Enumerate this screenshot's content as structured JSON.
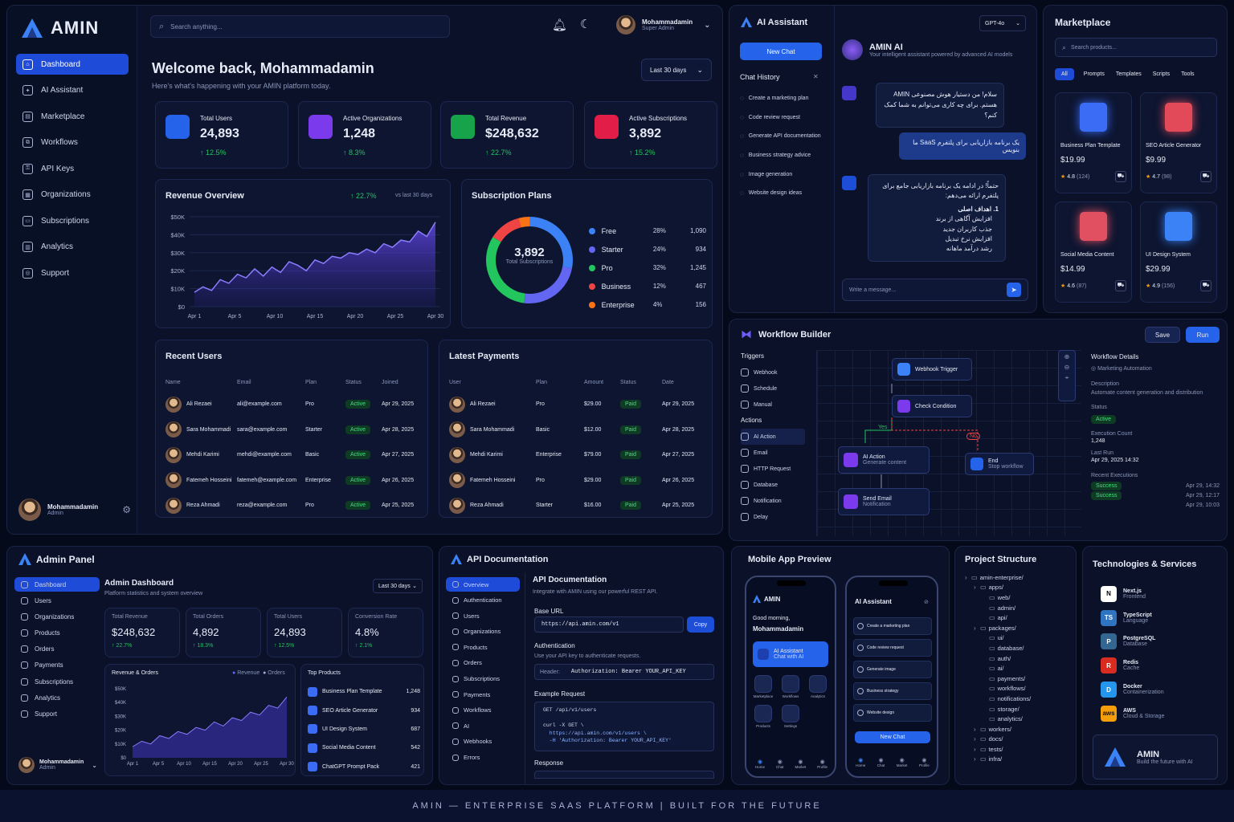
{
  "brand": {
    "name": "AMIN"
  },
  "sidebar": {
    "items": [
      {
        "label": "Dashboard",
        "icon": "home-icon"
      },
      {
        "label": "AI Assistant",
        "icon": "ai-icon"
      },
      {
        "label": "Marketplace",
        "icon": "store-icon"
      },
      {
        "label": "Workflows",
        "icon": "workflow-icon"
      },
      {
        "label": "API Keys",
        "icon": "key-icon"
      },
      {
        "label": "Organizations",
        "icon": "building-icon"
      },
      {
        "label": "Subscriptions",
        "icon": "card-icon"
      },
      {
        "label": "Analytics",
        "icon": "chart-icon"
      },
      {
        "label": "Support",
        "icon": "support-icon"
      }
    ],
    "user": {
      "name": "Mohammadamin",
      "role": "Admin"
    }
  },
  "topbar": {
    "search_placeholder": "Search anything...",
    "user_name": "Mohammadamin",
    "user_role": "Super Admin"
  },
  "welcome": {
    "title": "Welcome back, Mohammadamin",
    "subtitle": "Here's what's happening with your AMIN platform today.",
    "range": "Last 30 days"
  },
  "stats": [
    {
      "label": "Total Users",
      "value": "24,893",
      "delta": "↑ 12.5%",
      "color": "#2563eb"
    },
    {
      "label": "Active Organizations",
      "value": "1,248",
      "delta": "↑ 8.3%",
      "color": "#7c3aed"
    },
    {
      "label": "Total Revenue",
      "value": "$248,632",
      "delta": "↑ 22.7%",
      "color": "#16a34a"
    },
    {
      "label": "Active Subscriptions",
      "value": "3,892",
      "delta": "↑ 15.2%",
      "color": "#e11d48"
    }
  ],
  "revenue": {
    "title": "Revenue Overview",
    "delta": "↑ 22.7%",
    "compare": "vs last 30 days"
  },
  "chart_data": [
    {
      "type": "area",
      "title": "Revenue Overview",
      "x": [
        "Apr 1",
        "Apr 5",
        "Apr 10",
        "Apr 15",
        "Apr 20",
        "Apr 25",
        "Apr 30"
      ],
      "y_ticks": [
        "$50K",
        "$40K",
        "$30K",
        "$20K",
        "$10K",
        "$0"
      ],
      "ylim": [
        0,
        50000
      ],
      "series": [
        {
          "values": [
            8000,
            11000,
            9000,
            15000,
            13000,
            18000,
            16000,
            21000,
            17000,
            22000,
            19000,
            25000,
            23000,
            20000,
            26000,
            24000,
            28000,
            27000,
            30000,
            29000,
            32000,
            30000,
            35000,
            33000,
            37000,
            36000,
            42000,
            39000,
            47000
          ]
        }
      ]
    },
    {
      "type": "pie",
      "title": "Subscription Plans",
      "center_value": "3,892",
      "center_label": "Total Subscriptions",
      "series": [
        {
          "name": "Free",
          "pct": "28%",
          "count": "1,090",
          "value": 28,
          "color": "#3b82f6"
        },
        {
          "name": "Starter",
          "pct": "24%",
          "count": "934",
          "value": 24,
          "color": "#6366f1"
        },
        {
          "name": "Pro",
          "pct": "32%",
          "count": "1,245",
          "value": 32,
          "color": "#22c55e"
        },
        {
          "name": "Business",
          "pct": "12%",
          "count": "467",
          "value": 12,
          "color": "#ef4444"
        },
        {
          "name": "Enterprise",
          "pct": "4%",
          "count": "156",
          "value": 4,
          "color": "#f97316"
        }
      ]
    },
    {
      "type": "area",
      "title": "Revenue & Orders",
      "x": [
        "Apr 1",
        "Apr 5",
        "Apr 10",
        "Apr 15",
        "Apr 20",
        "Apr 25",
        "Apr 30"
      ],
      "y_ticks": [
        "$50K",
        "$40K",
        "$30K",
        "$20K",
        "$10K",
        "$0"
      ],
      "legend": [
        "Revenue",
        "Orders"
      ],
      "series": [
        {
          "name": "Revenue",
          "values": [
            8000,
            12000,
            10000,
            16000,
            14000,
            19000,
            17000,
            22000,
            20000,
            26000,
            23000,
            29000,
            27000,
            33000,
            31000,
            38000,
            36000,
            44000
          ]
        }
      ]
    }
  ],
  "plans_title": "Subscription Plans",
  "recent_users": {
    "title": "Recent Users",
    "cols": [
      "Name",
      "Email",
      "Plan",
      "Status",
      "Joined"
    ],
    "rows": [
      [
        "Ali Rezaei",
        "ali@example.com",
        "Pro",
        "Active",
        "Apr 29, 2025"
      ],
      [
        "Sara Mohammadi",
        "sara@example.com",
        "Starter",
        "Active",
        "Apr 28, 2025"
      ],
      [
        "Mehdi Karimi",
        "mehdi@example.com",
        "Basic",
        "Active",
        "Apr 27, 2025"
      ],
      [
        "Fatemeh Hosseini",
        "fatemeh@example.com",
        "Enterprise",
        "Active",
        "Apr 26, 2025"
      ],
      [
        "Reza Ahmadi",
        "reza@example.com",
        "Pro",
        "Active",
        "Apr 25, 2025"
      ]
    ]
  },
  "payments": {
    "title": "Latest Payments",
    "cols": [
      "User",
      "Plan",
      "Amount",
      "Status",
      "Date"
    ],
    "rows": [
      [
        "Ali Rezaei",
        "Pro",
        "$29.00",
        "Paid",
        "Apr 29, 2025"
      ],
      [
        "Sara Mohammadi",
        "Basic",
        "$12.00",
        "Paid",
        "Apr 28, 2025"
      ],
      [
        "Mehdi Karimi",
        "Enterprise",
        "$79.00",
        "Paid",
        "Apr 27, 2025"
      ],
      [
        "Fatemeh Hosseini",
        "Pro",
        "$29.00",
        "Paid",
        "Apr 26, 2025"
      ],
      [
        "Reza Ahmadi",
        "Starter",
        "$16.00",
        "Paid",
        "Apr 25, 2025"
      ]
    ]
  },
  "ai": {
    "title": "AI Assistant",
    "model": "GPT-4o",
    "new_chat": "New Chat",
    "history_title": "Chat History",
    "history": [
      "Create a marketing plan",
      "Code review request",
      "Generate API documentation",
      "Business strategy advice",
      "Image generation",
      "Website design ideas"
    ],
    "bot_name": "AMIN AI",
    "bot_sub": "Your intelligent assistant powered by advanced AI models",
    "msg1": "سلام! من دستیار هوش مصنوعی AMIN هستم. برای چه کاری می‌توانم به شما کمک کنم؟",
    "msg2": "یک برنامه بازاریابی برای پلتفرم SaaS ما بنویس",
    "msg3a": "حتماً! در ادامه یک برنامه بازاریابی جامع برای پلتفرم ارائه می‌دهم:",
    "msg3b": "1. اهداف اصلی",
    "msg3c": [
      "افزایش آگاهی از برند",
      "جذب کاربران جدید",
      "افزایش نرخ تبدیل",
      "رشد درآمد ماهانه"
    ],
    "input_placeholder": "Write a message..."
  },
  "market": {
    "title": "Marketplace",
    "search_placeholder": "Search products...",
    "tabs": [
      "All",
      "Prompts",
      "Templates",
      "Scripts",
      "Tools"
    ],
    "products": [
      {
        "name": "Business Plan Template",
        "price": "$19.99",
        "rating": "4.8",
        "count": "(124)",
        "color": "#3b6cf6"
      },
      {
        "name": "SEO Article Generator",
        "price": "$9.99",
        "rating": "4.7",
        "count": "(98)",
        "color": "#e24a5a"
      },
      {
        "name": "Social Media Content",
        "price": "$14.99",
        "rating": "4.6",
        "count": "(87)",
        "color": "#e05060"
      },
      {
        "name": "UI Design System",
        "price": "$29.99",
        "rating": "4.9",
        "count": "(156)",
        "color": "#3b82f6"
      }
    ]
  },
  "workflow": {
    "title": "Workflow Builder",
    "save": "Save",
    "run": "Run",
    "triggers_title": "Triggers",
    "triggers": [
      "Webhook",
      "Schedule",
      "Manual"
    ],
    "actions_title": "Actions",
    "actions": [
      "AI Action",
      "Email",
      "HTTP Request",
      "Database",
      "Notification",
      "Delay"
    ],
    "nodes": {
      "webhook": "Webhook Trigger",
      "check": "Check Condition",
      "ai": "AI Action",
      "ai_sub": "Generate content",
      "end": "End",
      "end_sub": "Stop workflow",
      "email": "Send Email",
      "email_sub": "Notification",
      "yes": "Yes",
      "no": "No"
    },
    "details": {
      "title": "Workflow Details",
      "name": "Marketing Automation",
      "desc_label": "Description",
      "desc": "Automate content generation and distribution",
      "status_label": "Status",
      "status": "Active",
      "exec_label": "Execution Count",
      "exec": "1,248",
      "last_label": "Last Run",
      "last": "Apr 29, 2025 14:32",
      "recent_label": "Recent Executions",
      "recent": [
        {
          "s": "Success",
          "t": "Apr 29, 14:32"
        },
        {
          "s": "Success",
          "t": "Apr 29, 12:17"
        },
        {
          "s": "",
          "t": "Apr 29, 10:03"
        }
      ]
    }
  },
  "admin": {
    "title": "Admin Panel",
    "nav": [
      "Dashboard",
      "Users",
      "Organizations",
      "Products",
      "Orders",
      "Payments",
      "Subscriptions",
      "Analytics",
      "Support"
    ],
    "heading": "Admin Dashboard",
    "sub": "Platform statistics and system overview",
    "range": "Last 30 days",
    "stats": [
      {
        "label": "Total Revenue",
        "value": "$248,632",
        "delta": "↑ 22.7%"
      },
      {
        "label": "Total Orders",
        "value": "4,892",
        "delta": "↑ 18.3%"
      },
      {
        "label": "Total Users",
        "value": "24,893",
        "delta": "↑ 12.5%"
      },
      {
        "label": "Conversion Rate",
        "value": "4.8%",
        "delta": "↑ 2.1%"
      }
    ],
    "chart_title": "Revenue & Orders",
    "top_title": "Top Products",
    "top": [
      [
        "Business Plan Template",
        "1,248"
      ],
      [
        "SEO Article Generator",
        "934"
      ],
      [
        "UI Design System",
        "687"
      ],
      [
        "Social Media Content",
        "542"
      ],
      [
        "ChatGPT Prompt Pack",
        "421"
      ]
    ],
    "user": "Mohammadamin",
    "role": "Admin"
  },
  "api": {
    "title": "API Documentation",
    "nav": [
      "Overview",
      "Authentication",
      "Users",
      "Organizations",
      "Products",
      "Orders",
      "Subscriptions",
      "Payments",
      "Workflows",
      "AI",
      "Webhooks",
      "Errors"
    ],
    "heading": "API Documentation",
    "sub": "Integrate with AMIN using our powerful REST API.",
    "base_label": "Base URL",
    "base": "https://api.amin.com/v1",
    "copy": "Copy",
    "auth_label": "Authentication",
    "auth_sub": "Use your API key to authenticate requests.",
    "header_label": "Header:",
    "header_val": "Authorization: Bearer YOUR_API_KEY",
    "example_label": "Example Request",
    "code": [
      "GET /api/v1/users",
      "",
      "curl -X GET \\",
      "  https://api.amin.com/v1/users \\",
      "  -H 'Authorization: Bearer YOUR_API_KEY'"
    ],
    "response_label": "Response"
  },
  "mobile": {
    "title": "Mobile App Preview",
    "app": "AMIN",
    "greeting": "Good morning,",
    "name": "Mohammadamin",
    "ai_card": "AI Assistant",
    "ai_card_sub": "Chat with AI",
    "tiles": [
      "Marketplace",
      "Workflows",
      "Analytics",
      "Products",
      "Settings"
    ],
    "tabs": [
      "Home",
      "Chat",
      "Market",
      "Profile"
    ],
    "chat_title": "AI Assistant",
    "chat_items": [
      "Create a marketing plan",
      "Code review request",
      "Generate image",
      "Business strategy",
      "Website design"
    ],
    "new_chat": "New Chat"
  },
  "project": {
    "title": "Project Structure",
    "tree": [
      [
        "amin-enterprise/",
        0
      ],
      [
        "apps/",
        1
      ],
      [
        "web/",
        2
      ],
      [
        "admin/",
        2
      ],
      [
        "api/",
        2
      ],
      [
        "packages/",
        1
      ],
      [
        "ui/",
        2
      ],
      [
        "database/",
        2
      ],
      [
        "auth/",
        2
      ],
      [
        "ai/",
        2
      ],
      [
        "payments/",
        2
      ],
      [
        "workflows/",
        2
      ],
      [
        "notifications/",
        2
      ],
      [
        "storage/",
        2
      ],
      [
        "analytics/",
        2
      ],
      [
        "workers/",
        1
      ],
      [
        "docs/",
        1
      ],
      [
        "tests/",
        1
      ],
      [
        "infra/",
        1
      ]
    ]
  },
  "tech": {
    "title": "Technologies & Services",
    "items": [
      {
        "name": "Next.js",
        "sub": "Frontend",
        "badge": "N",
        "color": "#ffffff",
        "fg": "#000"
      },
      {
        "name": "TypeScript",
        "sub": "Language",
        "badge": "TS",
        "color": "#2f74c0",
        "fg": "#fff"
      },
      {
        "name": "PostgreSQL",
        "sub": "Database",
        "badge": "P",
        "color": "#336791",
        "fg": "#fff"
      },
      {
        "name": "Redis",
        "sub": "Cache",
        "badge": "R",
        "color": "#d82c20",
        "fg": "#fff"
      },
      {
        "name": "Docker",
        "sub": "Containerization",
        "badge": "D",
        "color": "#2496ed",
        "fg": "#fff"
      },
      {
        "name": "AWS",
        "sub": "Cloud & Storage",
        "badge": "aws",
        "color": "#f59e0b",
        "fg": "#111"
      }
    ],
    "brand": "AMIN",
    "tagline": "Build the future with AI"
  },
  "footer": "AMIN — ENTERPRISE SAAS PLATFORM | BUILT FOR THE FUTURE"
}
